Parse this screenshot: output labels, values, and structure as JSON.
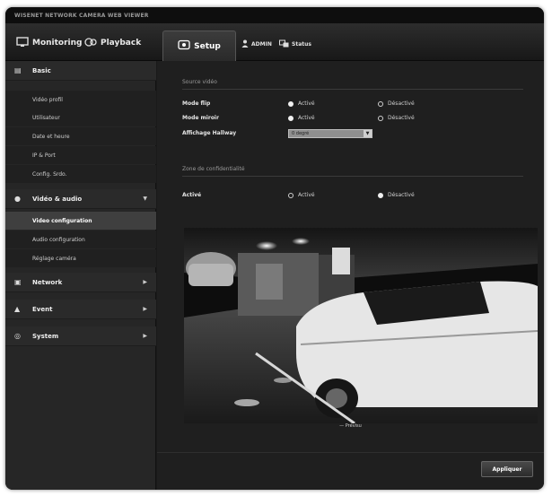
{
  "brand": "WISENET NETWORK CAMERA WEB VIEWER",
  "nav": {
    "monitoring": "Monitoring",
    "playback": "Playback",
    "setup": "Setup",
    "admin": "ADMIN",
    "status": "Status"
  },
  "sidebar": {
    "basic": "Basic",
    "basic_items": [
      "Vidéo profil",
      "Utilisateur",
      "Date et heure",
      "IP & Port",
      "Config. Srdo."
    ],
    "video_audio": "Vidéo & audio",
    "video_audio_items": [
      "Video configuration",
      "Audio configuration",
      "Réglage caméra"
    ],
    "network": "Network",
    "event": "Event",
    "system": "System"
  },
  "main": {
    "section1_title": "Source vidéo",
    "mode_flip_label": "Mode flip",
    "mode_mirror_label": "Mode miroir",
    "hallway_label": "Affichage Hallway",
    "active": "Activé",
    "disabled": "Désactivé",
    "hallway_value": "0 degré",
    "section2_title": "Zone de confidentialité",
    "enable_label": "Activé",
    "video_caption": "— Prévisu",
    "apply": "Appliquer"
  }
}
